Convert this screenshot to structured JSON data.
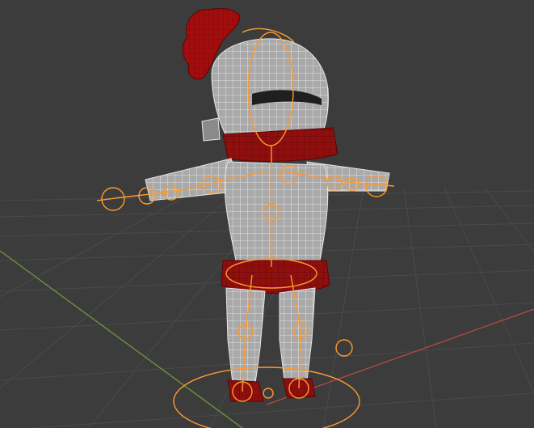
{
  "viewport": {
    "label": "",
    "colors": {
      "background": "#3c3c3c",
      "grid_line": "#4a4a4a",
      "x_axis": "#b7493f",
      "y_axis": "#6e9a3a",
      "armor_fill": "#a9a9a9",
      "armor_shadow": "#6b6b6b",
      "cloth_red": "#8f0f0f",
      "plume_red": "#a30d0d",
      "visor_dark": "#1f1f1f",
      "rig_orange": "#ff9a2e"
    },
    "scene_objects": [
      "grid-floor",
      "axis-x",
      "axis-y",
      "knight-mesh",
      "armature-rig",
      "root-control-circle"
    ]
  }
}
